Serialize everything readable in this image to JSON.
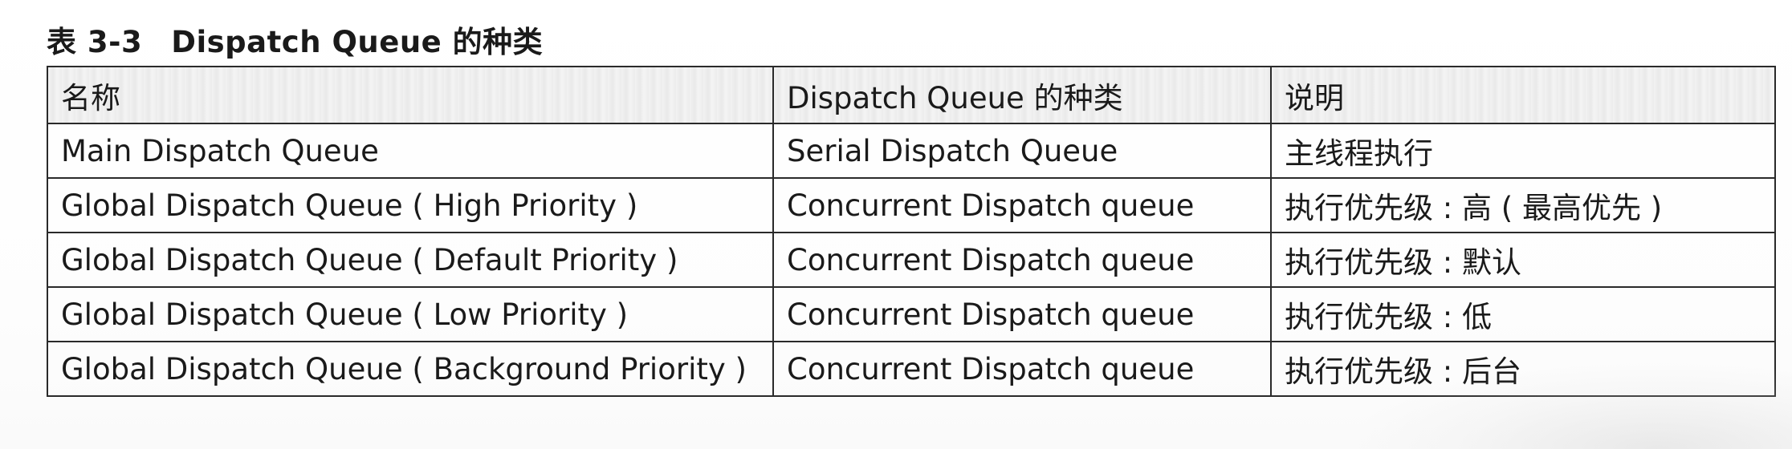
{
  "caption": {
    "number": "表 3-3",
    "title": "Dispatch Queue 的种类"
  },
  "table": {
    "headers": [
      "名称",
      "Dispatch Queue 的种类",
      "说明"
    ],
    "rows": [
      [
        "Main Dispatch Queue",
        "Serial Dispatch Queue",
        "主线程执行"
      ],
      [
        "Global Dispatch Queue ( High Priority )",
        "Concurrent Dispatch queue",
        "执行优先级 : 高 ( 最高优先 )"
      ],
      [
        "Global Dispatch Queue ( Default Priority )",
        "Concurrent Dispatch queue",
        "执行优先级 : 默认"
      ],
      [
        "Global Dispatch Queue ( Low Priority )",
        "Concurrent Dispatch queue",
        "执行优先级 : 低"
      ],
      [
        "Global Dispatch Queue ( Background Priority )",
        "Concurrent Dispatch queue",
        "执行优先级 : 后台"
      ]
    ]
  }
}
